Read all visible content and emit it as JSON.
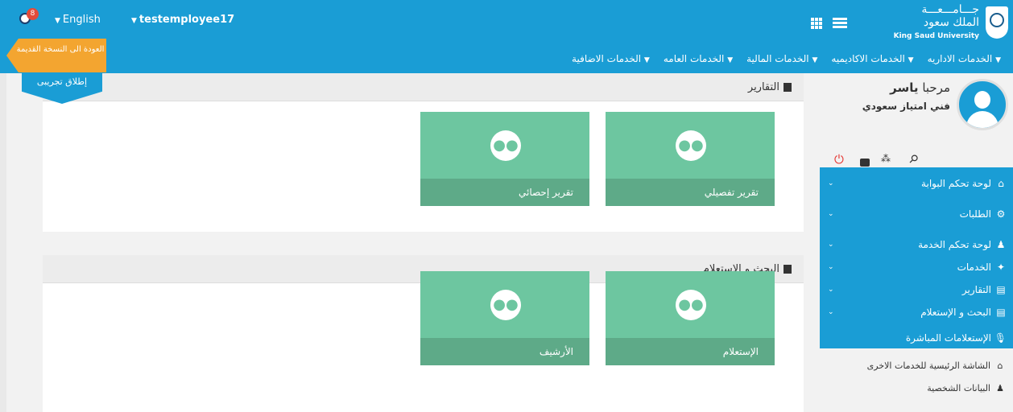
{
  "header": {
    "notification_count": "8",
    "language": "English",
    "username": "testemployee17",
    "logo_ar": "جـــامـــعـــة\nالملك سعود",
    "logo_en": "King Saud University"
  },
  "main_nav": [
    "الخدمات الاداريه",
    "الخدمات الاكاديميه",
    "الخدمات المالية",
    "الخدمات العامه",
    "الخدمات الاضافية"
  ],
  "old_version_label": "العودة الى النسخة القديمة",
  "beta_label": "إطلاق تجريبى",
  "reports": {
    "title": "التقارير",
    "tiles": [
      "تقرير تفصيلي",
      "تقرير إحصائي"
    ]
  },
  "search": {
    "title": "البحث و الإستعلام",
    "tiles": [
      "الإستعلام",
      "الأرشيف"
    ]
  },
  "profile": {
    "greeting_prefix": "مرحبا",
    "name": "ياسر",
    "role": "فني امتياز سعودي"
  },
  "sidebar_nav": [
    {
      "label": "لوحة تحكم البوابة",
      "icon": "home-icon"
    },
    {
      "label": "الطلبات",
      "icon": "gears-icon"
    },
    {
      "label": "لوحة تحكم الخدمة",
      "icon": "user-icon"
    },
    {
      "label": "الخدمات",
      "icon": "wrench-icon"
    },
    {
      "label": "التقارير",
      "icon": "document-icon"
    },
    {
      "label": "البحث و الإستعلام",
      "icon": "document-icon"
    },
    {
      "label": "الإستعلامات المباشرة",
      "icon": "microphone-icon"
    }
  ],
  "sidebar_sub": [
    "الشاشة الرئيسية للخدمات الاخرى",
    "البيانات الشخصية"
  ],
  "colors": {
    "primary": "#1a9dd5",
    "tile": "#6dc6a0",
    "tile_footer": "#5eaa88",
    "accent_orange": "#f3a530"
  }
}
